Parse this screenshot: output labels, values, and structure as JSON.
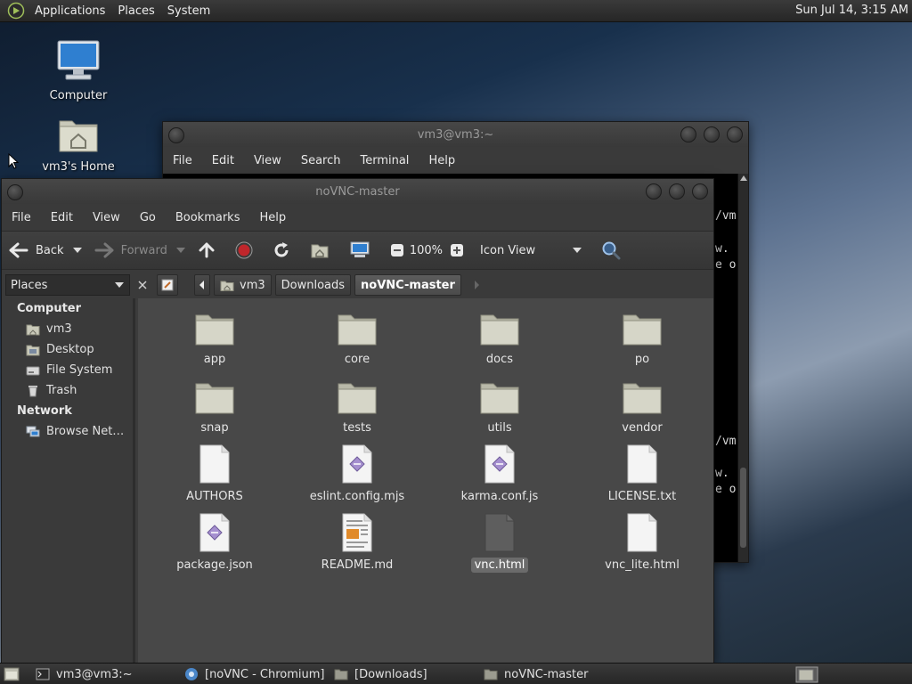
{
  "top_panel": {
    "menus": [
      "Applications",
      "Places",
      "System"
    ],
    "clock": "Sun Jul 14,  3:15 AM"
  },
  "desktop": {
    "icons": [
      {
        "label": "Computer",
        "icon": "computer-icon"
      },
      {
        "label": "vm3's Home",
        "icon": "home-folder-icon"
      }
    ]
  },
  "terminal": {
    "title": "vm3@vm3:~",
    "menus": [
      "File",
      "Edit",
      "View",
      "Search",
      "Terminal",
      "Help"
    ],
    "visible_fragments": [
      "/vm",
      "w.",
      "e o",
      "/vm",
      "w.",
      "e o"
    ]
  },
  "file_manager": {
    "title": "noVNC-master",
    "menus": [
      "File",
      "Edit",
      "View",
      "Go",
      "Bookmarks",
      "Help"
    ],
    "toolbar": {
      "back": "Back",
      "forward": "Forward",
      "zoom": "100%",
      "view_mode": "Icon View"
    },
    "sidebar": {
      "selector": "Places",
      "sections": [
        {
          "title": "Computer",
          "items": [
            {
              "label": "vm3",
              "icon": "home-icon"
            },
            {
              "label": "Desktop",
              "icon": "desktop-icon"
            },
            {
              "label": "File System",
              "icon": "drive-icon"
            },
            {
              "label": "Trash",
              "icon": "trash-icon"
            }
          ]
        },
        {
          "title": "Network",
          "items": [
            {
              "label": "Browse Net…",
              "icon": "network-icon"
            }
          ]
        }
      ]
    },
    "breadcrumbs": [
      "vm3",
      "Downloads",
      "noVNC-master"
    ],
    "files": [
      {
        "name": "app",
        "type": "folder"
      },
      {
        "name": "core",
        "type": "folder"
      },
      {
        "name": "docs",
        "type": "folder"
      },
      {
        "name": "po",
        "type": "folder"
      },
      {
        "name": "snap",
        "type": "folder"
      },
      {
        "name": "tests",
        "type": "folder"
      },
      {
        "name": "utils",
        "type": "folder"
      },
      {
        "name": "vendor",
        "type": "folder"
      },
      {
        "name": "AUTHORS",
        "type": "text"
      },
      {
        "name": "eslint.config.mjs",
        "type": "script"
      },
      {
        "name": "karma.conf.js",
        "type": "script"
      },
      {
        "name": "LICENSE.txt",
        "type": "text"
      },
      {
        "name": "package.json",
        "type": "script"
      },
      {
        "name": "README.md",
        "type": "document"
      },
      {
        "name": "vnc.html",
        "type": "html",
        "selected": true
      },
      {
        "name": "vnc_lite.html",
        "type": "text"
      }
    ]
  },
  "taskbar": {
    "items": [
      {
        "label": "vm3@vm3:~",
        "icon": "terminal-icon"
      },
      {
        "label": "[noVNC - Chromium]",
        "icon": "chromium-icon"
      },
      {
        "label": "[Downloads]",
        "icon": "folder-icon"
      },
      {
        "label": "noVNC-master",
        "icon": "folder-icon"
      }
    ]
  },
  "colors": {
    "panel": "#2f2f2f",
    "window": "#3c3c3c",
    "content": "#484848",
    "folder": "#d6d6c8"
  }
}
